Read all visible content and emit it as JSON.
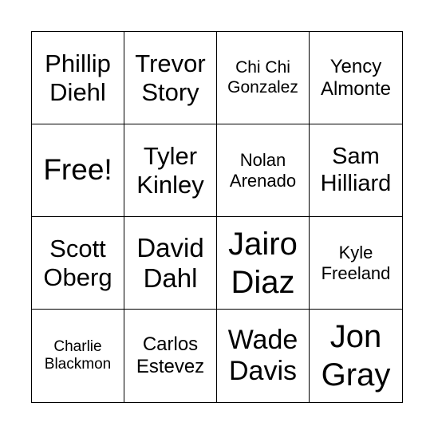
{
  "card": {
    "cells": [
      {
        "lines": [
          "Phillip",
          "Diehl"
        ]
      },
      {
        "lines": [
          "Trevor",
          "Story"
        ]
      },
      {
        "lines": [
          "Chi Chi",
          "Gonzalez"
        ]
      },
      {
        "lines": [
          "Yency",
          "Almonte"
        ]
      },
      {
        "lines": [
          "Free!"
        ]
      },
      {
        "lines": [
          "Tyler",
          "Kinley"
        ]
      },
      {
        "lines": [
          "Nolan",
          "Arenado"
        ]
      },
      {
        "lines": [
          "Sam",
          "Hilliard"
        ]
      },
      {
        "lines": [
          "Scott",
          "Oberg"
        ]
      },
      {
        "lines": [
          "David",
          "Dahl"
        ]
      },
      {
        "lines": [
          "Jairo",
          "Diaz"
        ]
      },
      {
        "lines": [
          "Kyle",
          "Freeland"
        ]
      },
      {
        "lines": [
          "Charlie",
          "Blackmon"
        ]
      },
      {
        "lines": [
          "Carlos",
          "Estevez"
        ]
      },
      {
        "lines": [
          "Wade",
          "Davis"
        ]
      },
      {
        "lines": [
          "Jon",
          "Gray"
        ]
      }
    ]
  }
}
